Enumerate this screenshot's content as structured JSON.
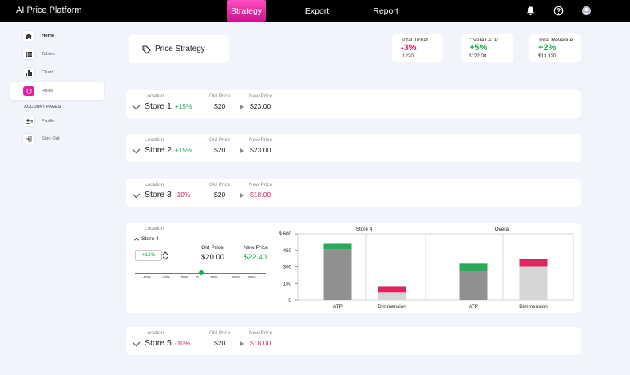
{
  "app": {
    "title": "AI Price Platform"
  },
  "nav": {
    "strategy": "Strategy",
    "export": "Export",
    "report": "Report"
  },
  "sidebar": {
    "items": [
      {
        "label": "Home",
        "icon": "home-icon"
      },
      {
        "label": "Tables",
        "icon": "table-icon"
      },
      {
        "label": "Chart",
        "icon": "bar-chart-icon"
      },
      {
        "label": "Rules",
        "icon": "rules-icon"
      }
    ],
    "section_header": "ACCOUNT PAGES",
    "account_items": [
      {
        "label": "Profile",
        "icon": "profile-icon"
      },
      {
        "label": "Sign Out",
        "icon": "sign-out-icon"
      }
    ]
  },
  "page": {
    "title": "Price Strategy"
  },
  "stats": [
    {
      "label": "Total Ticket",
      "value": "-3%",
      "sub": "1220",
      "color": "#e1174f"
    },
    {
      "label": "Overall ATP",
      "value": "+5%",
      "sub": "$122.00",
      "color": "#1bab4e"
    },
    {
      "label": "Total Revenue",
      "value": "+2%",
      "sub": "$13,320",
      "color": "#1bab4e"
    }
  ],
  "columns": {
    "location": "Location",
    "old_price": "Old Price",
    "new_price": "New Price"
  },
  "stores": [
    {
      "name": "Store 1",
      "pct": "+15%",
      "old": "$20",
      "new": "$23.00"
    },
    {
      "name": "Store 2",
      "pct": "+15%",
      "old": "$20",
      "new": "$23.00"
    },
    {
      "name": "Store 3",
      "pct": "-10%",
      "old": "$20",
      "new": "$18.00"
    },
    {
      "name": "Store 5",
      "pct": "-10%",
      "old": "$20",
      "new": "$18.00"
    }
  ],
  "expanded": {
    "location_label": "Location",
    "store": "Store 4",
    "stepper_value": "+12%",
    "old_label": "Old Price",
    "old_value": "$20.00",
    "new_label": "New Price",
    "new_value": "$22.40",
    "slider": {
      "ticks": [
        "-80%",
        "-40%",
        "-20%",
        "0",
        "20%",
        "60%",
        "80%"
      ],
      "value": "0"
    }
  },
  "chart_data": {
    "type": "bar",
    "stacked": true,
    "panels": [
      "Store 4",
      "Overal"
    ],
    "categories": [
      "ATP",
      "Dimmension",
      "ATP",
      "Dimmension"
    ],
    "y_ticks": [
      "$ 600",
      "450",
      "300",
      "150",
      "0"
    ],
    "ylim": [
      0,
      600
    ],
    "base_values": [
      460,
      70,
      260,
      300
    ],
    "top_values": [
      50,
      50,
      70,
      70
    ],
    "colors": {
      "atp_base": "#909090",
      "atp_top": "#2aaa57",
      "dim_base": "#d5d5d5",
      "dim_top": "#e2245c"
    }
  }
}
